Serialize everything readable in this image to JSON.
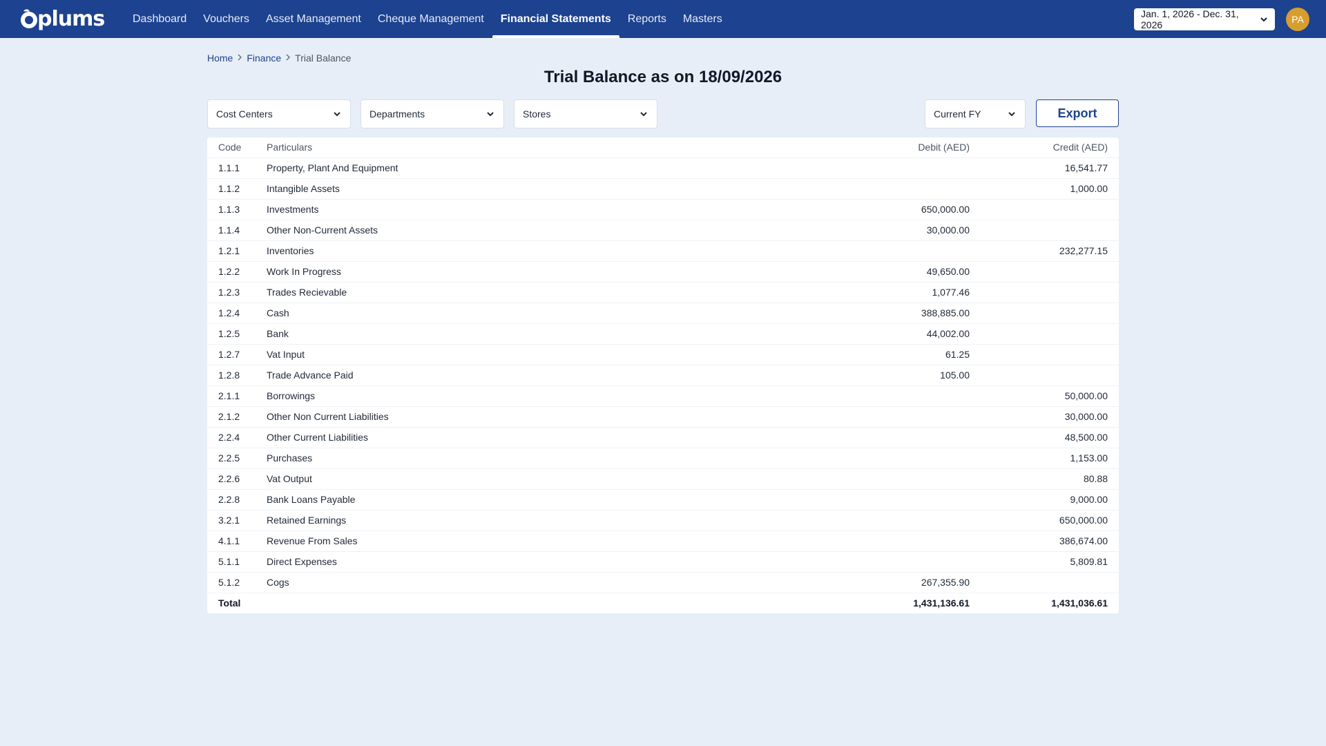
{
  "brand": {
    "name": "plums"
  },
  "nav": {
    "items": [
      {
        "label": "Dashboard",
        "active": false
      },
      {
        "label": "Vouchers",
        "active": false
      },
      {
        "label": "Asset Management",
        "active": false
      },
      {
        "label": "Cheque Management",
        "active": false
      },
      {
        "label": "Financial Statements",
        "active": true
      },
      {
        "label": "Reports",
        "active": false
      },
      {
        "label": "Masters",
        "active": false
      }
    ],
    "date_range": "Jan. 1, 2026 - Dec. 31, 2026",
    "avatar_initials": "PA",
    "avatar_color": "#d69e2e",
    "brand_color": "#1d428f"
  },
  "breadcrumb": {
    "home": "Home",
    "finance": "Finance",
    "current": "Trial Balance"
  },
  "page_title": "Trial Balance as on 18/09/2026",
  "filters": {
    "cost_centers": "Cost Centers",
    "departments": "Departments",
    "stores": "Stores",
    "period": "Current FY",
    "export_label": "Export"
  },
  "table": {
    "headers": {
      "code": "Code",
      "particulars": "Particulars",
      "debit": "Debit (AED)",
      "credit": "Credit (AED)"
    },
    "rows": [
      {
        "code": "1.1.1",
        "particulars": "Property, Plant And Equipment",
        "debit": "",
        "credit": "16,541.77"
      },
      {
        "code": "1.1.2",
        "particulars": "Intangible Assets",
        "debit": "",
        "credit": "1,000.00"
      },
      {
        "code": "1.1.3",
        "particulars": "Investments",
        "debit": "650,000.00",
        "credit": ""
      },
      {
        "code": "1.1.4",
        "particulars": "Other Non-Current Assets",
        "debit": "30,000.00",
        "credit": ""
      },
      {
        "code": "1.2.1",
        "particulars": "Inventories",
        "debit": "",
        "credit": "232,277.15"
      },
      {
        "code": "1.2.2",
        "particulars": "Work In Progress",
        "debit": "49,650.00",
        "credit": ""
      },
      {
        "code": "1.2.3",
        "particulars": "Trades Recievable",
        "debit": "1,077.46",
        "credit": ""
      },
      {
        "code": "1.2.4",
        "particulars": "Cash",
        "debit": "388,885.00",
        "credit": ""
      },
      {
        "code": "1.2.5",
        "particulars": "Bank",
        "debit": "44,002.00",
        "credit": ""
      },
      {
        "code": "1.2.7",
        "particulars": "Vat Input",
        "debit": "61.25",
        "credit": ""
      },
      {
        "code": "1.2.8",
        "particulars": "Trade Advance Paid",
        "debit": "105.00",
        "credit": ""
      },
      {
        "code": "2.1.1",
        "particulars": "Borrowings",
        "debit": "",
        "credit": "50,000.00"
      },
      {
        "code": "2.1.2",
        "particulars": "Other Non Current Liabilities",
        "debit": "",
        "credit": "30,000.00"
      },
      {
        "code": "2.2.4",
        "particulars": "Other Current Liabilities",
        "debit": "",
        "credit": "48,500.00"
      },
      {
        "code": "2.2.5",
        "particulars": "Purchases",
        "debit": "",
        "credit": "1,153.00"
      },
      {
        "code": "2.2.6",
        "particulars": "Vat Output",
        "debit": "",
        "credit": "80.88"
      },
      {
        "code": "2.2.8",
        "particulars": "Bank Loans Payable",
        "debit": "",
        "credit": "9,000.00"
      },
      {
        "code": "3.2.1",
        "particulars": "Retained Earnings",
        "debit": "",
        "credit": "650,000.00"
      },
      {
        "code": "4.1.1",
        "particulars": "Revenue From Sales",
        "debit": "",
        "credit": "386,674.00"
      },
      {
        "code": "5.1.1",
        "particulars": "Direct Expenses",
        "debit": "",
        "credit": "5,809.81"
      },
      {
        "code": "5.1.2",
        "particulars": "Cogs",
        "debit": "267,355.90",
        "credit": ""
      }
    ],
    "total": {
      "label": "Total",
      "debit": "1,431,136.61",
      "credit": "1,431,036.61"
    }
  }
}
